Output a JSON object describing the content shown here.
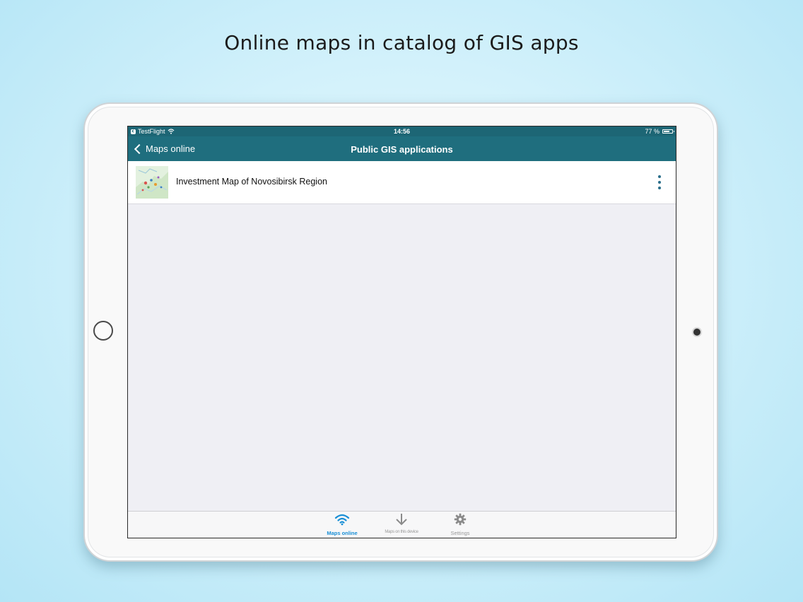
{
  "promo": {
    "headline": "Online maps in catalog of GIS apps"
  },
  "statusbar": {
    "carrier": "TestFlight",
    "time": "14:56",
    "battery": "77 %",
    "battery_level": 0.77
  },
  "navbar": {
    "back_label": "Maps online",
    "title": "Public GIS applications"
  },
  "list": {
    "items": [
      {
        "title": "Investment Map of Novosibirsk Region",
        "thumbnail": "map-thumbnail"
      }
    ]
  },
  "tabbar": {
    "tabs": [
      {
        "label": "Maps online",
        "icon": "wifi-icon",
        "active": true
      },
      {
        "label": "Maps on this device",
        "icon": "download-arrow-icon",
        "active": false
      },
      {
        "label": "Settings",
        "icon": "gear-icon",
        "active": false
      }
    ]
  },
  "colors": {
    "accent": "#1f6e7e",
    "tab_active": "#1a8fd6",
    "more_dots": "#2a6e8a"
  }
}
